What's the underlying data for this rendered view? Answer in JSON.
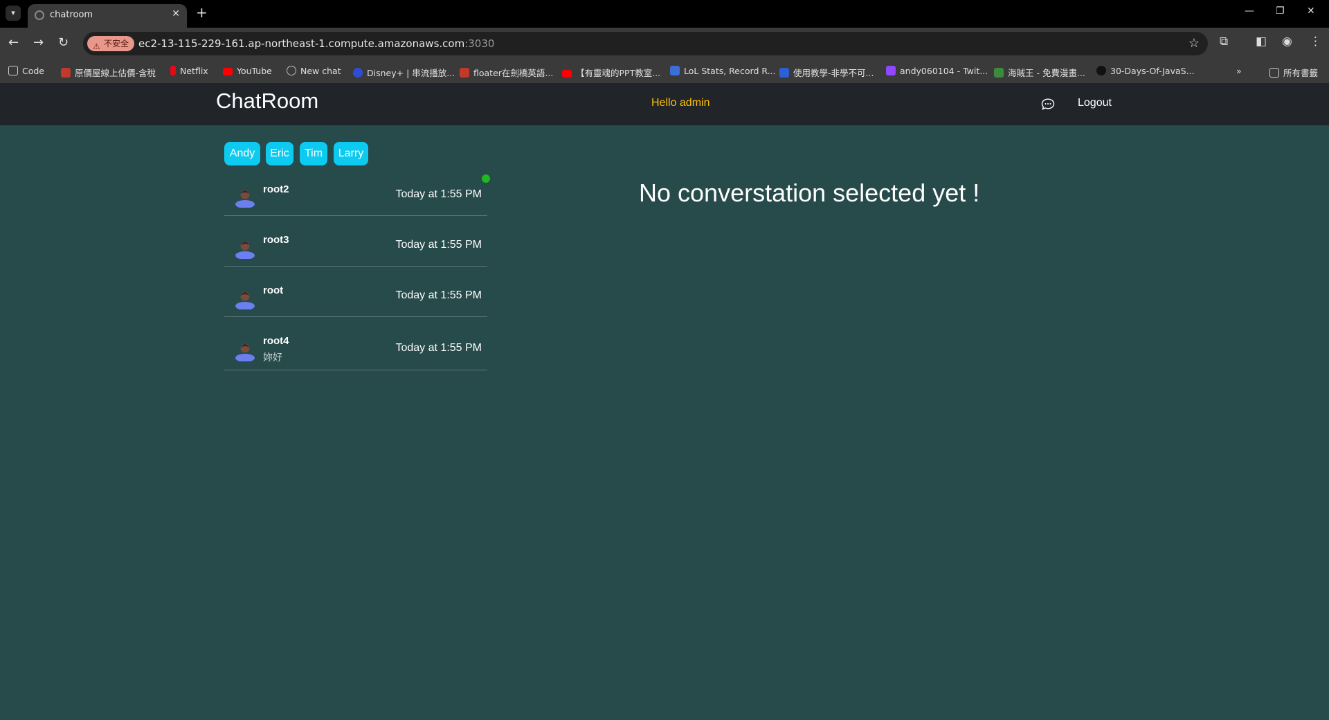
{
  "browser": {
    "tab_title": "chatroom",
    "insecure_label": "不安全",
    "url_host": "ec2-13-115-229-161.ap-northeast-1.compute.amazonaws.com",
    "url_port": ":3030",
    "bookmarks": [
      {
        "label": "Code",
        "icon": "folder-icon",
        "color": "#cfcfcf"
      },
      {
        "label": "原價屋線上估價-含稅",
        "icon": "store-icon",
        "color": "#c0392b"
      },
      {
        "label": "Netflix",
        "icon": "netflix-icon",
        "color": "#e50914"
      },
      {
        "label": "YouTube",
        "icon": "youtube-icon",
        "color": "#ff0000"
      },
      {
        "label": "New chat",
        "icon": "chatgpt-icon",
        "color": "#bfbfbf"
      },
      {
        "label": "Disney+ | 串流播放...",
        "icon": "disney-icon",
        "color": "#2f4cd6"
      },
      {
        "label": "floater在劍橋英語...",
        "icon": "cambridge-icon",
        "color": "#c0392b"
      },
      {
        "label": "【有靈魂的PPT教室...",
        "icon": "youtube-icon",
        "color": "#ff0000"
      },
      {
        "label": "LoL Stats, Record R...",
        "icon": "opgg-icon",
        "color": "#3b6fd8"
      },
      {
        "label": "使用教學-非學不可...",
        "icon": "book-icon",
        "color": "#2f5fd6"
      },
      {
        "label": "andy060104 - Twit...",
        "icon": "twitch-icon",
        "color": "#9146ff"
      },
      {
        "label": "海賊王 - 免費漫畫...",
        "icon": "manga-icon",
        "color": "#3d8a3d"
      },
      {
        "label": "30-Days-Of-JavaS...",
        "icon": "github-icon",
        "color": "#111111"
      }
    ],
    "all_bookmarks_label": "所有書籤"
  },
  "nav": {
    "brand": "ChatRoom",
    "greeting": "Hello admin",
    "logout": "Logout"
  },
  "chips": [
    "Andy",
    "Eric",
    "Tim",
    "Larry"
  ],
  "conversations": [
    {
      "name": "root2",
      "time": "Today at 1:55 PM",
      "last_message": "",
      "online": true
    },
    {
      "name": "root3",
      "time": "Today at 1:55 PM",
      "last_message": "",
      "online": false
    },
    {
      "name": "root",
      "time": "Today at 1:55 PM",
      "last_message": "",
      "online": false
    },
    {
      "name": "root4",
      "time": "Today at 1:55 PM",
      "last_message": "妳好",
      "online": false
    }
  ],
  "empty_state": "No converstation selected yet !",
  "colors": {
    "page_bg": "#274a4b",
    "navbar_bg": "#212529",
    "greeting": "#ffc107",
    "chip_bg": "#0dcaf0",
    "online": "#1db91d"
  }
}
